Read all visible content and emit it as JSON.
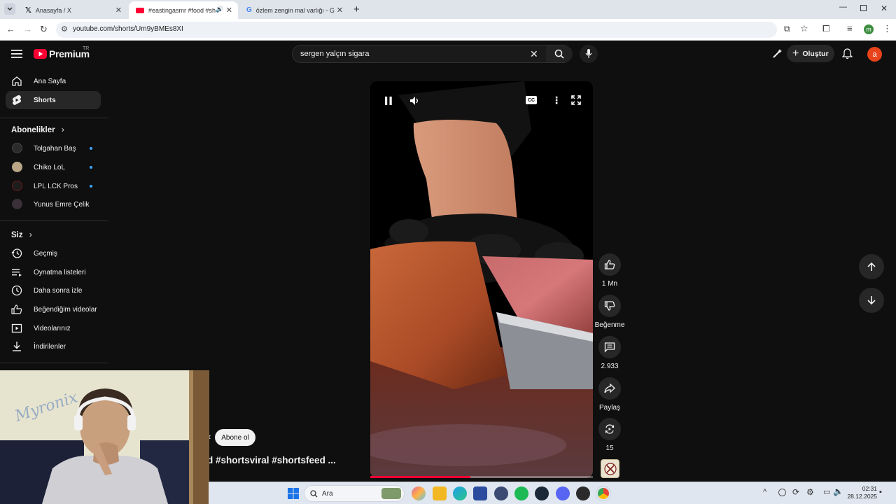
{
  "browser": {
    "tabs": [
      {
        "title": "Anasayfa / X",
        "active": false
      },
      {
        "title": "#eastingasmr #food #short",
        "active": true
      },
      {
        "title": "özlem zengin mal varlığı - Goo",
        "active": false
      }
    ],
    "url": "youtube.com/shorts/Um9yBMEs8XI",
    "profile_initial": "m"
  },
  "youtube": {
    "logo_text": "Premium",
    "logo_region": "TR",
    "search_value": "sergen yalçın sigara",
    "create_label": "Oluştur",
    "avatar_initial": "a",
    "brand_color": "#ff0033"
  },
  "sidebar": {
    "main": [
      {
        "label": "Ana Sayfa",
        "icon": "home-icon"
      },
      {
        "label": "Shorts",
        "icon": "shorts-icon",
        "active": true
      }
    ],
    "subscriptions_heading": "Abonelikler",
    "subscriptions": [
      {
        "label": "Tolgahan Baş",
        "new": true,
        "color": "#2b2b2b"
      },
      {
        "label": "Chiko LoL",
        "new": true,
        "color": "#b9a684"
      },
      {
        "label": "LPL LCK Pros",
        "new": true,
        "color": "#1d1d1d"
      },
      {
        "label": "Yunus Emre Çelik",
        "new": false,
        "color": "#3b3038"
      }
    ],
    "you_heading": "Siz",
    "you": [
      {
        "label": "Geçmiş",
        "icon": "history-icon"
      },
      {
        "label": "Oynatma listeleri",
        "icon": "playlists-icon"
      },
      {
        "label": "Daha sonra izle",
        "icon": "watch-later-icon"
      },
      {
        "label": "Beğendiğim videolar",
        "icon": "liked-icon"
      },
      {
        "label": "Videolarınız",
        "icon": "your-videos-icon"
      },
      {
        "label": "İndirilenler",
        "icon": "downloads-icon"
      }
    ]
  },
  "short": {
    "subscribe_label": "Abone ol",
    "title": "d #shortsviral #shortsfeed ...",
    "progress_fraction": 0.45,
    "actions": {
      "like_count": "1 Mn",
      "dislike_label": "Beğenme",
      "comments_count": "2.933",
      "share_label": "Paylaş",
      "remix_count": "15"
    }
  },
  "webcam": {
    "watermark": "Myronix"
  },
  "taskbar": {
    "search_placeholder": "Ara",
    "time": "02:31",
    "date": "28.12.2025"
  }
}
